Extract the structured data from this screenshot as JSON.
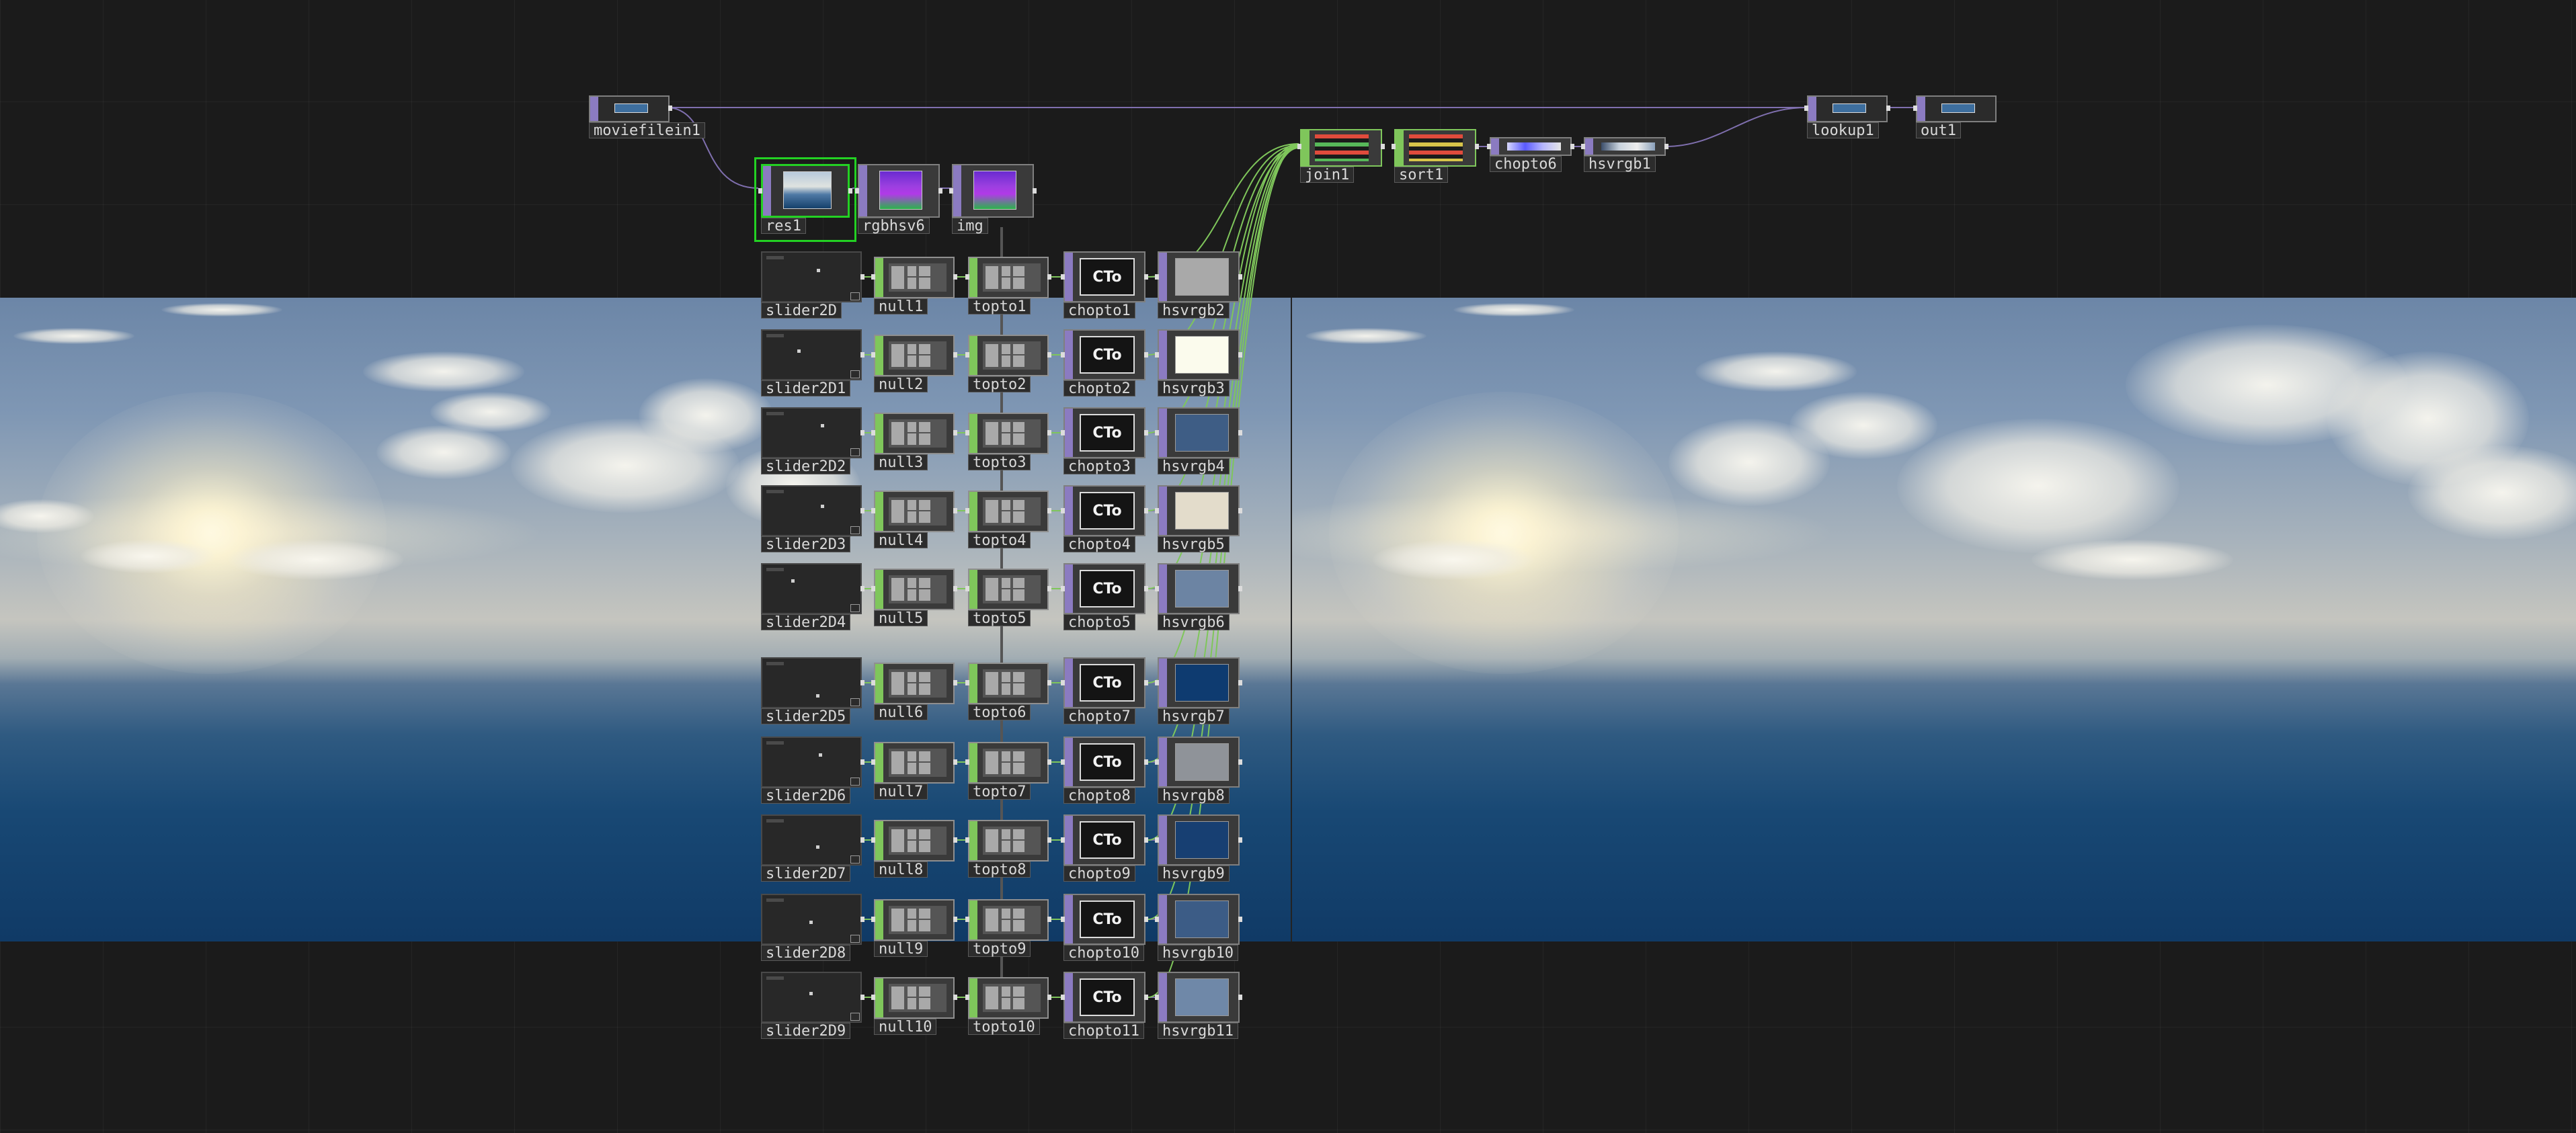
{
  "network": {
    "top_row": [
      {
        "id": "moviefilein1",
        "label": "moviefilein1"
      },
      {
        "id": "res1",
        "label": "res1"
      },
      {
        "id": "rgbhsv6",
        "label": "rgbhsv6"
      },
      {
        "id": "img",
        "label": "img"
      },
      {
        "id": "join1",
        "label": "join1"
      },
      {
        "id": "sort1",
        "label": "sort1"
      },
      {
        "id": "chopto6",
        "label": "chopto6"
      },
      {
        "id": "hsvrgb1",
        "label": "hsvrgb1"
      },
      {
        "id": "lookup1",
        "label": "lookup1"
      },
      {
        "id": "out1",
        "label": "out1"
      }
    ],
    "rows": [
      {
        "slider": "slider2D",
        "null": "null1",
        "topto": "topto1",
        "chopto": "chopto1",
        "hsvrgb": "hsvrgb2",
        "swatch": "#a9a9a9",
        "dot": [
          0.58,
          0.25
        ]
      },
      {
        "slider": "slider2D1",
        "null": "null2",
        "topto": "topto2",
        "chopto": "chopto2",
        "hsvrgb": "hsvrgb3",
        "swatch": "#fbfbed",
        "dot": [
          0.37,
          0.33
        ]
      },
      {
        "slider": "slider2D2",
        "null": "null3",
        "topto": "topto3",
        "chopto": "chopto3",
        "hsvrgb": "hsvrgb4",
        "swatch": "#3e5d85",
        "dot": [
          0.62,
          0.23
        ]
      },
      {
        "slider": "slider2D3",
        "null": "null4",
        "topto": "topto4",
        "chopto": "chopto4",
        "hsvrgb": "hsvrgb5",
        "swatch": "#e3dccb",
        "dot": [
          0.62,
          0.3
        ]
      },
      {
        "slider": "slider2D4",
        "null": "null5",
        "topto": "topto5",
        "chopto": "chopto5",
        "hsvrgb": "hsvrgb6",
        "swatch": "#6c84a3",
        "dot": [
          0.31,
          0.22
        ]
      },
      {
        "slider": "slider2D5",
        "null": "null6",
        "topto": "topto6",
        "chopto": "chopto7",
        "hsvrgb": "hsvrgb7",
        "swatch": "#0e3b70",
        "dot": [
          0.57,
          0.76
        ]
      },
      {
        "slider": "slider2D6",
        "null": "null7",
        "topto": "topto7",
        "chopto": "chopto8",
        "hsvrgb": "hsvrgb8",
        "swatch": "#8f9399",
        "dot": [
          0.6,
          0.23
        ]
      },
      {
        "slider": "slider2D7",
        "null": "null8",
        "topto": "topto8",
        "chopto": "chopto9",
        "hsvrgb": "hsvrgb9",
        "swatch": "#173f72",
        "dot": [
          0.57,
          0.6
        ]
      },
      {
        "slider": "slider2D8",
        "null": "null9",
        "topto": "topto9",
        "chopto": "chopto10",
        "hsvrgb": "hsvrgb10",
        "swatch": "#3c5c86",
        "dot": [
          0.5,
          0.5
        ]
      },
      {
        "slider": "slider2D9",
        "null": "null10",
        "topto": "topto10",
        "chopto": "chopto11",
        "hsvrgb": "hsvrgb11",
        "swatch": "#6f88a8",
        "dot": [
          0.5,
          0.32
        ]
      }
    ],
    "cto_text": "CTo"
  },
  "colors": {
    "canvas_bg": "#1b1b1b",
    "chop_family": "#8b7bc1",
    "sop_family": "#7fc65b",
    "selection": "#23d123",
    "wire_chop": "#7f6fae",
    "wire_sop": "#7fc65b"
  }
}
